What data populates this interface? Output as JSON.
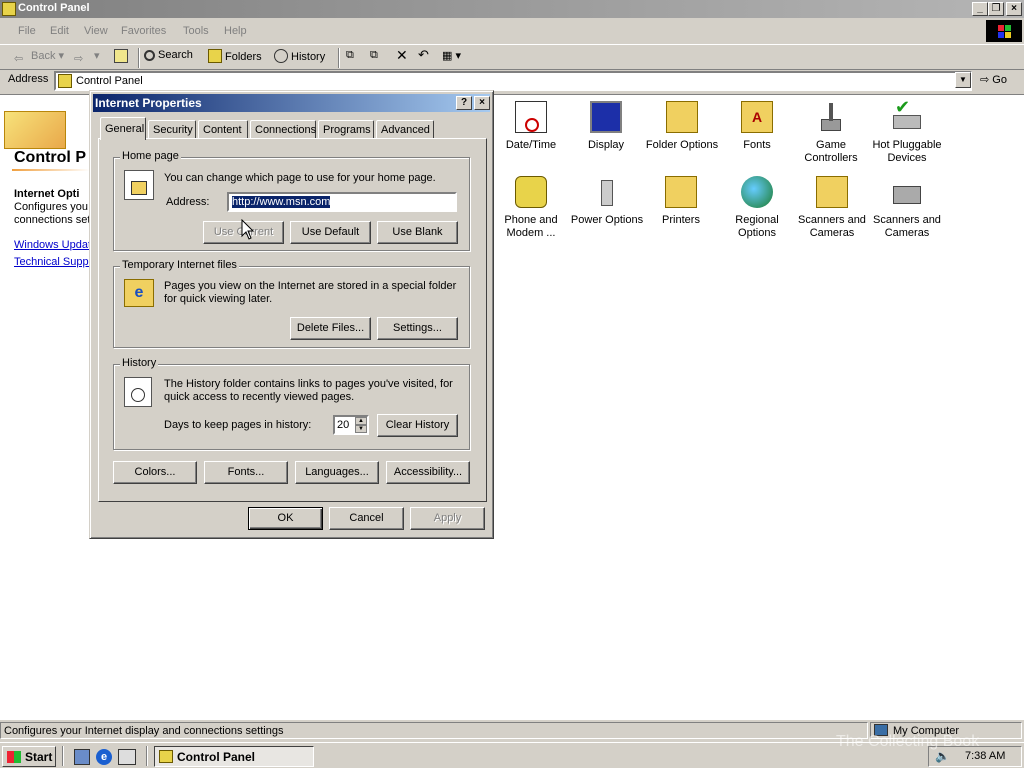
{
  "window": {
    "title": "Control Panel"
  },
  "menu": [
    "File",
    "Edit",
    "View",
    "Favorites",
    "Tools",
    "Help"
  ],
  "toolbar": {
    "back": "Back",
    "search": "Search",
    "folders": "Folders",
    "history": "History"
  },
  "address": {
    "label": "Address",
    "value": "Control Panel",
    "go": "Go"
  },
  "left_panel": {
    "heading": "Control P",
    "section_title": "Internet Opti",
    "desc_line1": "Configures you",
    "desc_line2": "connections set",
    "link1": "Windows Updat",
    "link2": "Technical Suppo"
  },
  "icons": [
    {
      "name": "date-time-icon",
      "l1": "Date/Time",
      "l2": ""
    },
    {
      "name": "display-icon",
      "l1": "Display",
      "l2": ""
    },
    {
      "name": "folder-options-icon",
      "l1": "Folder Options",
      "l2": ""
    },
    {
      "name": "fonts-icon",
      "l1": "Fonts",
      "l2": ""
    },
    {
      "name": "game-controllers-icon",
      "l1": "Game",
      "l2": "Controllers"
    },
    {
      "name": "hot-pluggable-icon",
      "l1": "Hot Pluggable",
      "l2": "Devices"
    },
    {
      "name": "phone-modem-icon",
      "l1": "Phone and",
      "l2": "Modem ..."
    },
    {
      "name": "power-options-icon",
      "l1": "Power Options",
      "l2": ""
    },
    {
      "name": "printers-icon",
      "l1": "Printers",
      "l2": ""
    },
    {
      "name": "regional-options-icon",
      "l1": "Regional",
      "l2": "Options"
    },
    {
      "name": "scanners-cameras-icon",
      "l1": "Scanners and",
      "l2": "Cameras"
    },
    {
      "name": "scanners-cameras-2-icon",
      "l1": "Scanners and",
      "l2": "Cameras"
    }
  ],
  "status": {
    "text": "Configures your Internet display and connections settings",
    "zone": "My Computer"
  },
  "taskbar": {
    "start": "Start",
    "task": "Control Panel",
    "clock": "7:38 AM"
  },
  "dialog": {
    "title": "Internet Properties",
    "help": "?",
    "close": "×",
    "tabs": [
      "General",
      "Security",
      "Content",
      "Connections",
      "Programs",
      "Advanced"
    ],
    "home": {
      "legend": "Home page",
      "desc": "You can change which page to use for your home page.",
      "address_label": "Address:",
      "address_value": "http://www.msn.com",
      "use_current": "Use Current",
      "use_default": "Use Default",
      "use_blank": "Use Blank"
    },
    "temp": {
      "legend": "Temporary Internet files",
      "desc1": "Pages you view on the Internet are stored in a special folder",
      "desc2": "for quick viewing later.",
      "delete": "Delete Files...",
      "settings": "Settings..."
    },
    "history": {
      "legend": "History",
      "desc1": "The History folder contains links to pages you've visited, for",
      "desc2": "quick access to recently viewed pages.",
      "days_label": "Days to keep pages in history:",
      "days_value": "20",
      "clear": "Clear History"
    },
    "bottom": {
      "colors": "Colors...",
      "fonts": "Fonts...",
      "languages": "Languages...",
      "accessibility": "Accessibility..."
    },
    "ok": "OK",
    "cancel": "Cancel",
    "apply": "Apply"
  },
  "watermark": "The Collecting Book"
}
